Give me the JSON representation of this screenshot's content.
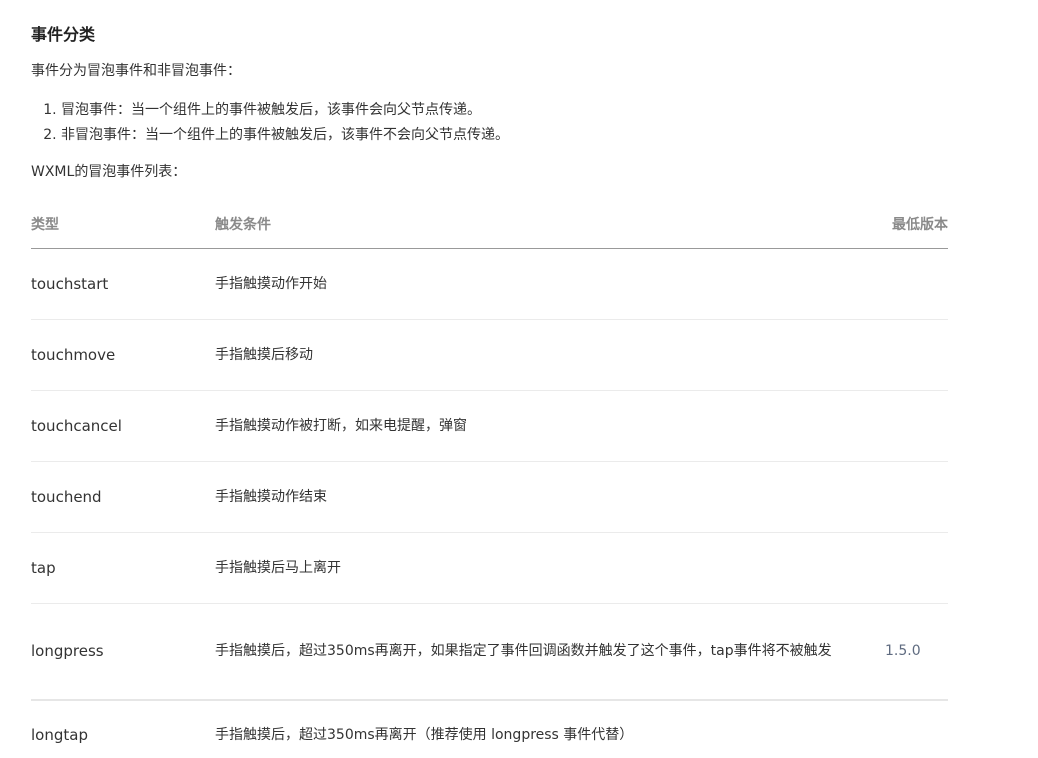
{
  "heading": "事件分类",
  "intro": "事件分为冒泡事件和非冒泡事件：",
  "list_items": [
    "冒泡事件：当一个组件上的事件被触发后，该事件会向父节点传递。",
    "非冒泡事件：当一个组件上的事件被触发后，该事件不会向父节点传递。"
  ],
  "list_title": "WXML的冒泡事件列表：",
  "table": {
    "headers": [
      "类型",
      "触发条件",
      "最低版本"
    ],
    "rows": [
      {
        "type": "touchstart",
        "desc": "手指触摸动作开始",
        "version": ""
      },
      {
        "type": "touchmove",
        "desc": "手指触摸后移动",
        "version": ""
      },
      {
        "type": "touchcancel",
        "desc": "手指触摸动作被打断，如来电提醒，弹窗",
        "version": ""
      },
      {
        "type": "touchend",
        "desc": "手指触摸动作结束",
        "version": ""
      },
      {
        "type": "tap",
        "desc": "手指触摸后马上离开",
        "version": ""
      },
      {
        "type": "longpress",
        "desc": "手指触摸后，超过350ms再离开，如果指定了事件回调函数并触发了这个事件，tap事件将不被触发",
        "version": "1.5.0"
      },
      {
        "type": "longtap",
        "desc": "手指触摸后，超过350ms再离开（推荐使用 longpress 事件代替）",
        "version": ""
      }
    ]
  }
}
